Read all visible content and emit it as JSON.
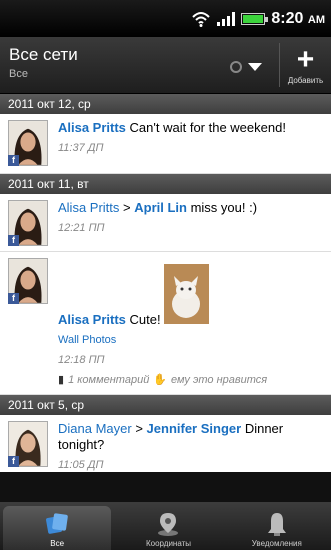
{
  "status": {
    "time": "8:20",
    "ampm": "AM"
  },
  "header": {
    "title": "Все сети",
    "subtitle": "Все",
    "add_label": "Добавить"
  },
  "dates": [
    "2011 окт 12, ср",
    "2011 окт 11, вт",
    "2011 окт 5, ср"
  ],
  "posts": [
    {
      "author": "Alisa Pritts",
      "text": "Can't wait for the weekend!",
      "time": "11:37 ДП"
    },
    {
      "author": "Alisa Pritts",
      "arrow": ">",
      "target": "April Lin",
      "text": "miss you! :)",
      "time": "12:21 ПП"
    },
    {
      "author": "Alisa Pritts",
      "text": "Cute!",
      "album": "Wall Photos",
      "time": "12:18 ПП",
      "comments": "1 комментарий",
      "likes": "ему это нравится"
    },
    {
      "author": "Diana Mayer",
      "arrow": ">",
      "target": "Jennifer Singer",
      "text": "Dinner tonight?",
      "time": "11:05 ДП"
    }
  ],
  "tabs": [
    {
      "label": "Все",
      "icon": "all-updates-icon"
    },
    {
      "label": "Координаты",
      "icon": "location-pin-icon"
    },
    {
      "label": "Уведомления",
      "icon": "notifications-bell-icon"
    }
  ],
  "colors": {
    "link": "#1a6fc0",
    "facebook": "#3b5998",
    "date_header": "#4a4a4a"
  }
}
